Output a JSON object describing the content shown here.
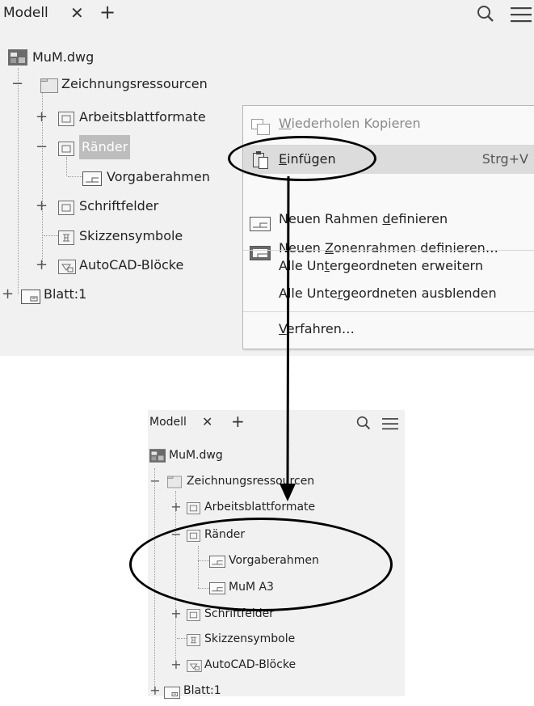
{
  "panel1": {
    "tab_label": "Modell",
    "close_glyph": "✕",
    "add_glyph": "+",
    "tree": {
      "root": "MuM.dwg",
      "resources": "Zeichnungsressourcen",
      "sheet_formats": "Arbeitsblattformate",
      "borders": "Ränder",
      "default_border": "Vorgaberahmen",
      "title_blocks": "Schriftfelder",
      "sketch_symbols": "Skizzensymbole",
      "autocad_blocks": "AutoCAD-Blöcke",
      "sheet": "Blatt:1"
    }
  },
  "context_menu": {
    "items": [
      {
        "pre": "",
        "u": "W",
        "post": "iederholen Kopieren",
        "shortcut": "",
        "disabled": true
      },
      {
        "pre": "",
        "u": "E",
        "post": "infügen",
        "shortcut": "Strg+V",
        "highlighted": true
      },
      {
        "pre": "Neuen Rahmen ",
        "u": "d",
        "post": "efinieren",
        "shortcut": ""
      },
      {
        "pre": "Neuen ",
        "u": "Z",
        "post": "onenrahmen definieren…",
        "shortcut": ""
      },
      {
        "pre": "Alle Un",
        "u": "t",
        "post": "ergeordneten erweitern",
        "shortcut": ""
      },
      {
        "pre": "Alle Unte",
        "u": "r",
        "post": "geordneten ausblenden",
        "shortcut": ""
      },
      {
        "pre": "",
        "u": "V",
        "post": "erfahren…",
        "shortcut": ""
      }
    ]
  },
  "panel2": {
    "tab_label": "Modell",
    "close_glyph": "✕",
    "add_glyph": "+",
    "tree": {
      "root": "MuM.dwg",
      "resources": "Zeichnungsressourcen",
      "sheet_formats": "Arbeitsblattformate",
      "borders": "Ränder",
      "default_border": "Vorgaberahmen",
      "new_border": "MuM A3",
      "title_blocks": "Schriftfelder",
      "sketch_symbols": "Skizzensymbole",
      "autocad_blocks": "AutoCAD-Blöcke",
      "sheet": "Blatt:1"
    }
  },
  "icons": {
    "file": "drawing-file-icon",
    "folder": "folder-icon",
    "sheet_format": "sheet-format-icon",
    "border": "border-icon",
    "title_block": "title-block-icon",
    "sketch_symbol": "sketch-symbol-icon",
    "autocad_block": "autocad-block-icon",
    "sheet": "sheet-icon",
    "search": "search-icon",
    "menu": "hamburger-menu-icon",
    "copy": "copy-icon",
    "paste": "paste-icon",
    "define_border": "define-border-icon",
    "define_zone_border": "define-zone-border-icon"
  }
}
